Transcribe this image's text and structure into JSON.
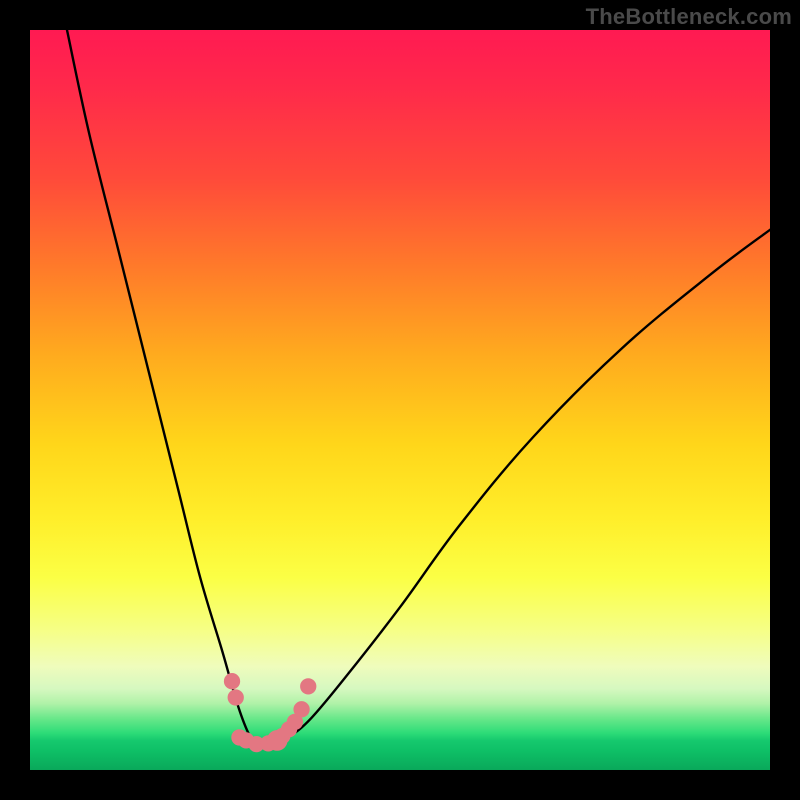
{
  "watermark": "TheBottleneck.com",
  "chart_data": {
    "type": "line",
    "title": "",
    "xlabel": "",
    "ylabel": "",
    "xlim": [
      0,
      100
    ],
    "ylim": [
      0,
      100
    ],
    "grid": false,
    "series": [
      {
        "name": "bottleneck-curve",
        "x": [
          5,
          8,
          12,
          16,
          20,
          23,
          26,
          28,
          29.5,
          30.5,
          31.5,
          33,
          35,
          38,
          43,
          50,
          58,
          68,
          80,
          92,
          100
        ],
        "values": [
          100,
          86,
          70,
          54,
          38,
          26,
          16,
          9,
          5,
          3.7,
          3.5,
          3.7,
          4.5,
          7,
          13,
          22,
          33,
          45,
          57,
          67,
          73
        ]
      }
    ],
    "markers": {
      "name": "bottleneck-markers",
      "color": "#e37782",
      "points": [
        {
          "x": 27.3,
          "y": 12.0,
          "r": 1.1
        },
        {
          "x": 27.8,
          "y": 9.8,
          "r": 1.1
        },
        {
          "x": 28.3,
          "y": 4.4,
          "r": 1.1
        },
        {
          "x": 29.2,
          "y": 4.0,
          "r": 1.1
        },
        {
          "x": 30.6,
          "y": 3.5,
          "r": 1.1
        },
        {
          "x": 32.2,
          "y": 3.6,
          "r": 1.1
        },
        {
          "x": 33.4,
          "y": 4.0,
          "r": 1.4
        },
        {
          "x": 34.1,
          "y": 4.6,
          "r": 1.1
        },
        {
          "x": 35.0,
          "y": 5.5,
          "r": 1.1
        },
        {
          "x": 35.8,
          "y": 6.5,
          "r": 1.1
        },
        {
          "x": 36.7,
          "y": 8.2,
          "r": 1.1
        },
        {
          "x": 37.6,
          "y": 11.3,
          "r": 1.1
        }
      ]
    },
    "gradient_stops": [
      {
        "pos": 0,
        "color": "#ff1a52"
      },
      {
        "pos": 0.5,
        "color": "#ffe030"
      },
      {
        "pos": 0.88,
        "color": "#f0ffb0"
      },
      {
        "pos": 1.0,
        "color": "#0aa85a"
      }
    ]
  }
}
